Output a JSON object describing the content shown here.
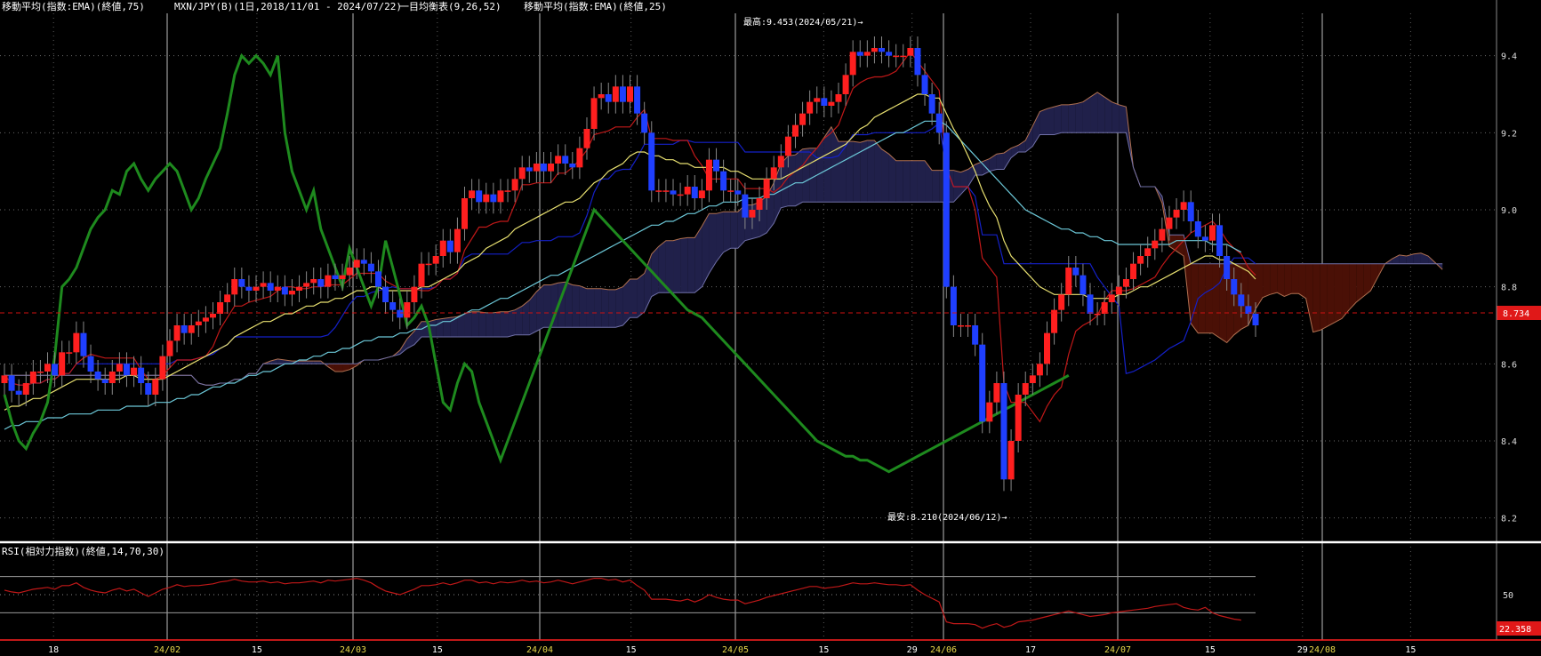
{
  "header": {
    "ema75": "移動平均(指数:EMA)(終値,75)",
    "symbol": "MXN/JPY(B)(1日,2018/11/01 - 2024/07/22)",
    "ichimoku": "一目均衡表(9,26,52)",
    "ema25": "移動平均(指数:EMA)(終値,25)"
  },
  "annotations": {
    "high": "最高:9.453(2024/05/21)→",
    "low": "最安:8.210(2024/06/12)→"
  },
  "last_price": "8.734",
  "rsi_label": "RSI(相対力指数)(終値,14,70,30)",
  "rsi_last": "22.358",
  "colors": {
    "up": "#ff1f1f",
    "down": "#1f3fff",
    "ema25": "#e8e070",
    "ema75": "#6cc8d8",
    "tenkan": "#c01818",
    "kijun": "#1420c8",
    "chikou": "#1e8a1e",
    "kumo_bear": "#4a1006",
    "kumo_bull": "#20204a",
    "rsi": "#c01818"
  },
  "chart_data": {
    "type": "candlestick",
    "ylim": [
      8.16,
      9.51
    ],
    "yticks": [
      "9.4",
      "9.2",
      "9.0",
      "8.8",
      "8.6",
      "8.4",
      "8.2"
    ],
    "rsi_ylim": [
      0,
      100
    ],
    "rsi_ticks": [
      "50"
    ],
    "xticks": [
      {
        "date": "2024-01-18",
        "label": "18"
      },
      {
        "date": "2024-02-01",
        "label": "24/02"
      },
      {
        "date": "2024-02-15",
        "label": "15"
      },
      {
        "date": "2024-03-01",
        "label": "24/03"
      },
      {
        "date": "2024-03-15",
        "label": "15"
      },
      {
        "date": "2024-04-01",
        "label": "24/04"
      },
      {
        "date": "2024-04-15",
        "label": "15"
      },
      {
        "date": "2024-05-01",
        "label": "24/05"
      },
      {
        "date": "2024-05-15",
        "label": "15"
      },
      {
        "date": "2024-05-29",
        "label": "29"
      },
      {
        "date": "2024-06-03",
        "label": "24/06"
      },
      {
        "date": "2024-06-17",
        "label": "17"
      },
      {
        "date": "2024-07-01",
        "label": "24/07"
      },
      {
        "date": "2024-07-15",
        "label": "15"
      },
      {
        "date": "2024-07-29",
        "label": "29"
      },
      {
        "date": "2024-08-01",
        "label": "24/08"
      },
      {
        "date": "2024-08-15",
        "label": "15"
      }
    ],
    "closes": [
      8.57,
      8.53,
      8.52,
      8.55,
      8.58,
      8.58,
      8.6,
      8.57,
      8.63,
      8.63,
      8.68,
      8.62,
      8.58,
      8.56,
      8.55,
      8.58,
      8.6,
      8.57,
      8.59,
      8.55,
      8.52,
      8.56,
      8.62,
      8.66,
      8.7,
      8.68,
      8.7,
      8.71,
      8.72,
      8.73,
      8.76,
      8.78,
      8.82,
      8.8,
      8.79,
      8.8,
      8.81,
      8.79,
      8.8,
      8.78,
      8.79,
      8.8,
      8.81,
      8.82,
      8.8,
      8.83,
      8.82,
      8.83,
      8.85,
      8.87,
      8.86,
      8.84,
      8.8,
      8.76,
      8.74,
      8.72,
      8.76,
      8.8,
      8.86,
      8.86,
      8.88,
      8.92,
      8.89,
      8.95,
      9.03,
      9.05,
      9.02,
      9.04,
      9.02,
      9.05,
      9.05,
      9.08,
      9.11,
      9.1,
      9.12,
      9.1,
      9.12,
      9.14,
      9.12,
      9.11,
      9.16,
      9.21,
      9.29,
      9.3,
      9.28,
      9.32,
      9.28,
      9.32,
      9.25,
      9.2,
      9.05,
      9.05,
      9.05,
      9.04,
      9.04,
      9.06,
      9.03,
      9.05,
      9.13,
      9.1,
      9.05,
      9.05,
      9.04,
      8.98,
      9.0,
      9.03,
      9.08,
      9.11,
      9.14,
      9.19,
      9.22,
      9.25,
      9.28,
      9.29,
      9.27,
      9.28,
      9.3,
      9.35,
      9.41,
      9.4,
      9.41,
      9.42,
      9.41,
      9.4,
      9.4,
      9.4,
      9.42,
      9.35,
      9.3,
      9.25,
      9.2,
      8.8,
      8.7,
      8.7,
      8.7,
      8.65,
      8.45,
      8.5,
      8.55,
      8.3,
      8.4,
      8.52,
      8.55,
      8.57,
      8.6,
      8.68,
      8.74,
      8.78,
      8.85,
      8.83,
      8.78,
      8.73,
      8.73,
      8.76,
      8.78,
      8.8,
      8.82,
      8.86,
      8.88,
      8.9,
      8.92,
      8.95,
      8.98,
      9.0,
      9.02,
      8.97,
      8.93,
      8.92,
      8.96,
      8.88,
      8.82,
      8.78,
      8.75,
      8.73,
      8.7
    ],
    "ema25": [
      8.48,
      8.49,
      8.49,
      8.5,
      8.51,
      8.51,
      8.52,
      8.53,
      8.54,
      8.55,
      8.56,
      8.56,
      8.56,
      8.56,
      8.56,
      8.56,
      8.56,
      8.57,
      8.57,
      8.56,
      8.56,
      8.56,
      8.56,
      8.57,
      8.58,
      8.59,
      8.6,
      8.61,
      8.62,
      8.63,
      8.64,
      8.65,
      8.67,
      8.68,
      8.69,
      8.7,
      8.71,
      8.71,
      8.72,
      8.73,
      8.73,
      8.74,
      8.75,
      8.75,
      8.76,
      8.76,
      8.77,
      8.77,
      8.78,
      8.79,
      8.79,
      8.8,
      8.8,
      8.79,
      8.79,
      8.79,
      8.79,
      8.79,
      8.8,
      8.8,
      8.81,
      8.82,
      8.83,
      8.84,
      8.86,
      8.87,
      8.88,
      8.9,
      8.91,
      8.92,
      8.93,
      8.95,
      8.96,
      8.97,
      8.98,
      8.99,
      9.0,
      9.01,
      9.02,
      9.02,
      9.03,
      9.05,
      9.07,
      9.08,
      9.1,
      9.11,
      9.12,
      9.14,
      9.15,
      9.15,
      9.14,
      9.14,
      9.13,
      9.13,
      9.12,
      9.12,
      9.11,
      9.11,
      9.11,
      9.11,
      9.11,
      9.1,
      9.1,
      9.09,
      9.08,
      9.08,
      9.08,
      9.08,
      9.08,
      9.09,
      9.1,
      9.11,
      9.12,
      9.13,
      9.14,
      9.15,
      9.16,
      9.17,
      9.19,
      9.21,
      9.22,
      9.24,
      9.25,
      9.26,
      9.27,
      9.28,
      9.29,
      9.3,
      9.3,
      9.29,
      9.29,
      9.25,
      9.21,
      9.18,
      9.14,
      9.1,
      9.05,
      9.01,
      8.98,
      8.92,
      8.88,
      8.86,
      8.84,
      8.82,
      8.8,
      8.79,
      8.78,
      8.78,
      8.78,
      8.78,
      8.78,
      8.77,
      8.77,
      8.77,
      8.77,
      8.78,
      8.78,
      8.79,
      8.8,
      8.8,
      8.81,
      8.82,
      8.83,
      8.84,
      8.85,
      8.86,
      8.87,
      8.88,
      8.88,
      8.87,
      8.87,
      8.86,
      8.85,
      8.84,
      8.82
    ],
    "ema75": [
      8.43,
      8.44,
      8.44,
      8.45,
      8.45,
      8.45,
      8.46,
      8.46,
      8.46,
      8.47,
      8.47,
      8.47,
      8.47,
      8.48,
      8.48,
      8.48,
      8.48,
      8.49,
      8.49,
      8.49,
      8.49,
      8.5,
      8.5,
      8.5,
      8.51,
      8.51,
      8.52,
      8.52,
      8.53,
      8.54,
      8.54,
      8.55,
      8.55,
      8.56,
      8.57,
      8.57,
      8.58,
      8.58,
      8.59,
      8.6,
      8.6,
      8.61,
      8.61,
      8.62,
      8.62,
      8.63,
      8.63,
      8.64,
      8.64,
      8.65,
      8.66,
      8.66,
      8.67,
      8.67,
      8.67,
      8.68,
      8.68,
      8.69,
      8.69,
      8.7,
      8.7,
      8.71,
      8.71,
      8.72,
      8.73,
      8.74,
      8.74,
      8.75,
      8.76,
      8.77,
      8.77,
      8.78,
      8.79,
      8.8,
      8.81,
      8.82,
      8.83,
      8.83,
      8.84,
      8.85,
      8.86,
      8.87,
      8.88,
      8.89,
      8.9,
      8.91,
      8.92,
      8.93,
      8.94,
      8.95,
      8.96,
      8.96,
      8.97,
      8.97,
      8.98,
      8.99,
      8.99,
      9.0,
      9.01,
      9.01,
      9.02,
      9.02,
      9.02,
      9.03,
      9.03,
      9.03,
      9.04,
      9.04,
      9.05,
      9.06,
      9.07,
      9.07,
      9.08,
      9.09,
      9.1,
      9.11,
      9.12,
      9.13,
      9.14,
      9.15,
      9.16,
      9.17,
      9.18,
      9.19,
      9.2,
      9.2,
      9.21,
      9.22,
      9.23,
      9.23,
      9.23,
      9.22,
      9.2,
      9.18,
      9.16,
      9.14,
      9.12,
      9.1,
      9.08,
      9.06,
      9.04,
      9.02,
      9.0,
      8.99,
      8.98,
      8.97,
      8.96,
      8.95,
      8.95,
      8.94,
      8.94,
      8.93,
      8.93,
      8.92,
      8.92,
      8.91,
      8.91,
      8.91,
      8.91,
      8.91,
      8.91,
      8.91,
      8.91,
      8.92,
      8.92,
      8.92,
      8.92,
      8.92,
      8.91,
      8.91,
      8.91,
      8.9,
      8.89
    ],
    "rsi": [
      55,
      53,
      52,
      54,
      56,
      57,
      58,
      56,
      60,
      60,
      63,
      58,
      55,
      53,
      52,
      55,
      57,
      54,
      56,
      52,
      48,
      52,
      56,
      58,
      61,
      59,
      60,
      60,
      61,
      62,
      64,
      65,
      67,
      65,
      64,
      64,
      65,
      63,
      64,
      62,
      63,
      63,
      64,
      65,
      63,
      66,
      65,
      66,
      67,
      68,
      66,
      63,
      58,
      54,
      52,
      50,
      53,
      56,
      60,
      60,
      61,
      63,
      61,
      63,
      66,
      66,
      63,
      64,
      62,
      64,
      63,
      64,
      66,
      64,
      65,
      63,
      64,
      66,
      64,
      62,
      64,
      66,
      68,
      68,
      66,
      67,
      64,
      66,
      60,
      55,
      45,
      45,
      45,
      44,
      43,
      45,
      42,
      45,
      50,
      47,
      45,
      44,
      44,
      40,
      42,
      44,
      47,
      49,
      51,
      53,
      55,
      57,
      59,
      59,
      57,
      58,
      59,
      61,
      63,
      62,
      62,
      63,
      62,
      61,
      61,
      60,
      61,
      55,
      50,
      46,
      42,
      20,
      18,
      18,
      18,
      17,
      13,
      16,
      18,
      14,
      16,
      20,
      21,
      22,
      24,
      26,
      28,
      30,
      32,
      30,
      28,
      26,
      27,
      28,
      30,
      31,
      32,
      33,
      34,
      35,
      37,
      38,
      39,
      40,
      36,
      34,
      33,
      36,
      30,
      27,
      25,
      23,
      22
    ],
    "chikou": [
      8.52,
      8.45,
      8.4,
      8.38,
      8.42,
      8.45,
      8.5,
      8.62,
      8.8,
      8.82,
      8.85,
      8.9,
      8.95,
      8.98,
      9.0,
      9.05,
      9.04,
      9.1,
      9.12,
      9.08,
      9.05,
      9.08,
      9.1,
      9.12,
      9.1,
      9.05,
      9.0,
      9.03,
      9.08,
      9.12,
      9.16,
      9.25,
      9.35,
      9.4,
      9.38,
      9.4,
      9.38,
      9.35,
      9.4,
      9.2,
      9.1,
      9.05,
      9.0,
      9.05,
      8.95,
      8.9,
      8.85,
      8.8,
      8.9,
      8.85,
      8.8,
      8.75,
      8.8,
      8.92,
      8.85,
      8.78,
      8.7,
      8.72,
      8.75,
      8.7,
      8.6,
      8.5,
      8.48,
      8.55,
      8.6,
      8.58,
      8.5,
      8.45,
      8.4,
      8.35,
      8.4,
      8.45,
      8.5,
      8.55,
      8.6,
      8.65,
      8.7,
      8.75,
      8.8,
      8.85,
      8.9,
      8.95,
      9.0,
      8.98,
      8.96,
      8.94,
      8.92,
      8.9,
      8.88,
      8.86,
      8.84,
      8.82,
      8.8,
      8.78,
      8.76,
      8.74,
      8.73,
      8.72,
      8.7,
      8.68,
      8.66,
      8.64,
      8.62,
      8.6,
      8.58,
      8.56,
      8.54,
      8.52,
      8.5,
      8.48,
      8.46,
      8.44,
      8.42,
      8.4,
      8.39,
      8.38,
      8.37,
      8.36,
      8.36,
      8.35,
      8.35,
      8.34,
      8.33,
      8.32,
      8.33,
      8.34,
      8.35,
      8.36,
      8.37,
      8.38,
      8.39,
      8.4,
      8.41,
      8.42,
      8.43,
      8.44,
      8.45,
      8.46,
      8.47,
      8.48,
      8.49,
      8.5,
      8.51,
      8.52,
      8.53,
      8.54,
      8.55,
      8.56,
      8.57,
      8.58,
      8.59,
      8.6,
      8.61,
      8.62,
      8.63,
      8.64,
      8.65,
      8.66,
      8.67,
      8.68,
      8.69,
      8.7,
      8.71,
      8.72,
      8.73,
      8.74,
      8.75,
      8.76,
      8.77,
      8.78,
      8.79,
      8.8,
      8.81,
      8.82,
      8.83,
      8.84,
      8.85
    ]
  }
}
